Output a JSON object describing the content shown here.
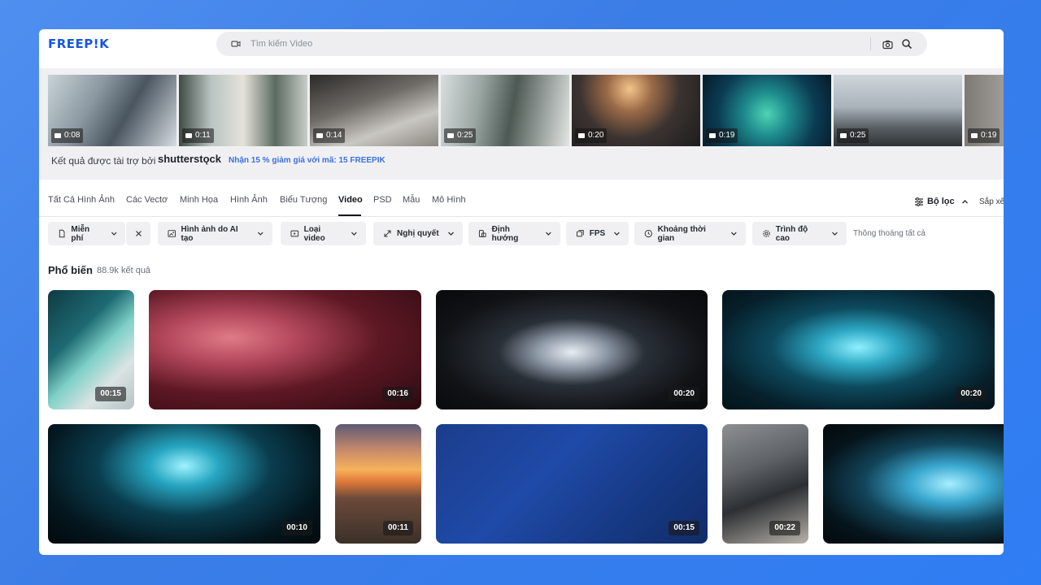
{
  "brand": {
    "logo": "FREEP!K"
  },
  "search": {
    "placeholder": "Tìm kiếm Video"
  },
  "sponsored": {
    "note": "Kết quả được tài trợ bởi",
    "partner": "shutterstǫck",
    "promo": "Nhận 15 % giảm giá với mã: 15 FREEPIK",
    "thumbnails": [
      {
        "duration": "0:08"
      },
      {
        "duration": "0:11"
      },
      {
        "duration": "0:14"
      },
      {
        "duration": "0:25"
      },
      {
        "duration": "0:20"
      },
      {
        "duration": "0:19"
      },
      {
        "duration": "0:25"
      },
      {
        "duration": "0:19"
      }
    ]
  },
  "tabs": [
    {
      "label": "Tất Cả Hình Ảnh"
    },
    {
      "label": "Các Vectơ"
    },
    {
      "label": "Minh Họa"
    },
    {
      "label": "Hình Ảnh"
    },
    {
      "label": "Biểu Tượng"
    },
    {
      "label": "Video",
      "active": true
    },
    {
      "label": "PSD"
    },
    {
      "label": "Mẫu"
    },
    {
      "label": "Mô Hình"
    }
  ],
  "toolbar": {
    "filter_label": "Bộ lọc",
    "sort_label": "Sắp xếp"
  },
  "filters": {
    "free": "Miễn phí",
    "ai": "Hình ảnh do AI tạo",
    "type": "Loại video",
    "resolution": "Nghị quyết",
    "orientation": "Định hướng",
    "fps": "FPS",
    "duration": "Khoảng thời gian",
    "advanced": "Trình độ cao",
    "clear_all": "Thông thoáng tất cả"
  },
  "results": {
    "title": "Phổ biến",
    "count": "88.9k kết quả",
    "cards": [
      {
        "duration": "00:15"
      },
      {
        "duration": "00:16"
      },
      {
        "duration": "00:20"
      },
      {
        "duration": "00:20"
      },
      {
        "duration": "00:10"
      },
      {
        "duration": "00:11"
      },
      {
        "duration": "00:15"
      },
      {
        "duration": "00:22"
      },
      {
        "duration": ""
      }
    ]
  }
}
